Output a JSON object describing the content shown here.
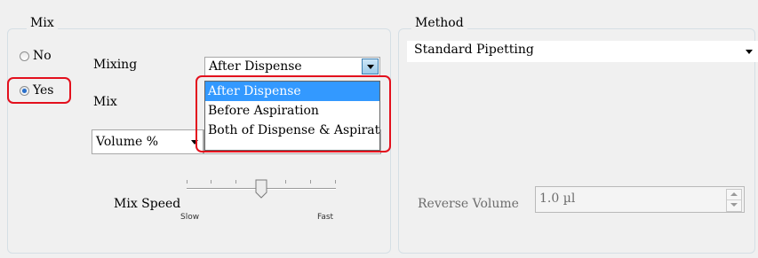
{
  "mix_group": {
    "legend": "Mix",
    "radio_no": "No",
    "radio_yes": "Yes",
    "mixing_label": "Mixing",
    "mixing_value": "After Dispense",
    "mixing_options": [
      "After Dispense",
      "Before Aspiration",
      "Both of Dispense & Aspiration"
    ],
    "mix_label": "Mix",
    "volume_value": "Volume %",
    "speed_label": "Mix Speed",
    "speed_slow": "Slow",
    "speed_fast": "Fast",
    "speed_level": 0.5
  },
  "method_group": {
    "legend": "Method",
    "method_value": "Standard Pipetting",
    "reverse_label": "Reverse Volume",
    "reverse_value": "1.0 µl"
  },
  "colors": {
    "highlight": "#e3101d",
    "selection": "#3399ff"
  }
}
